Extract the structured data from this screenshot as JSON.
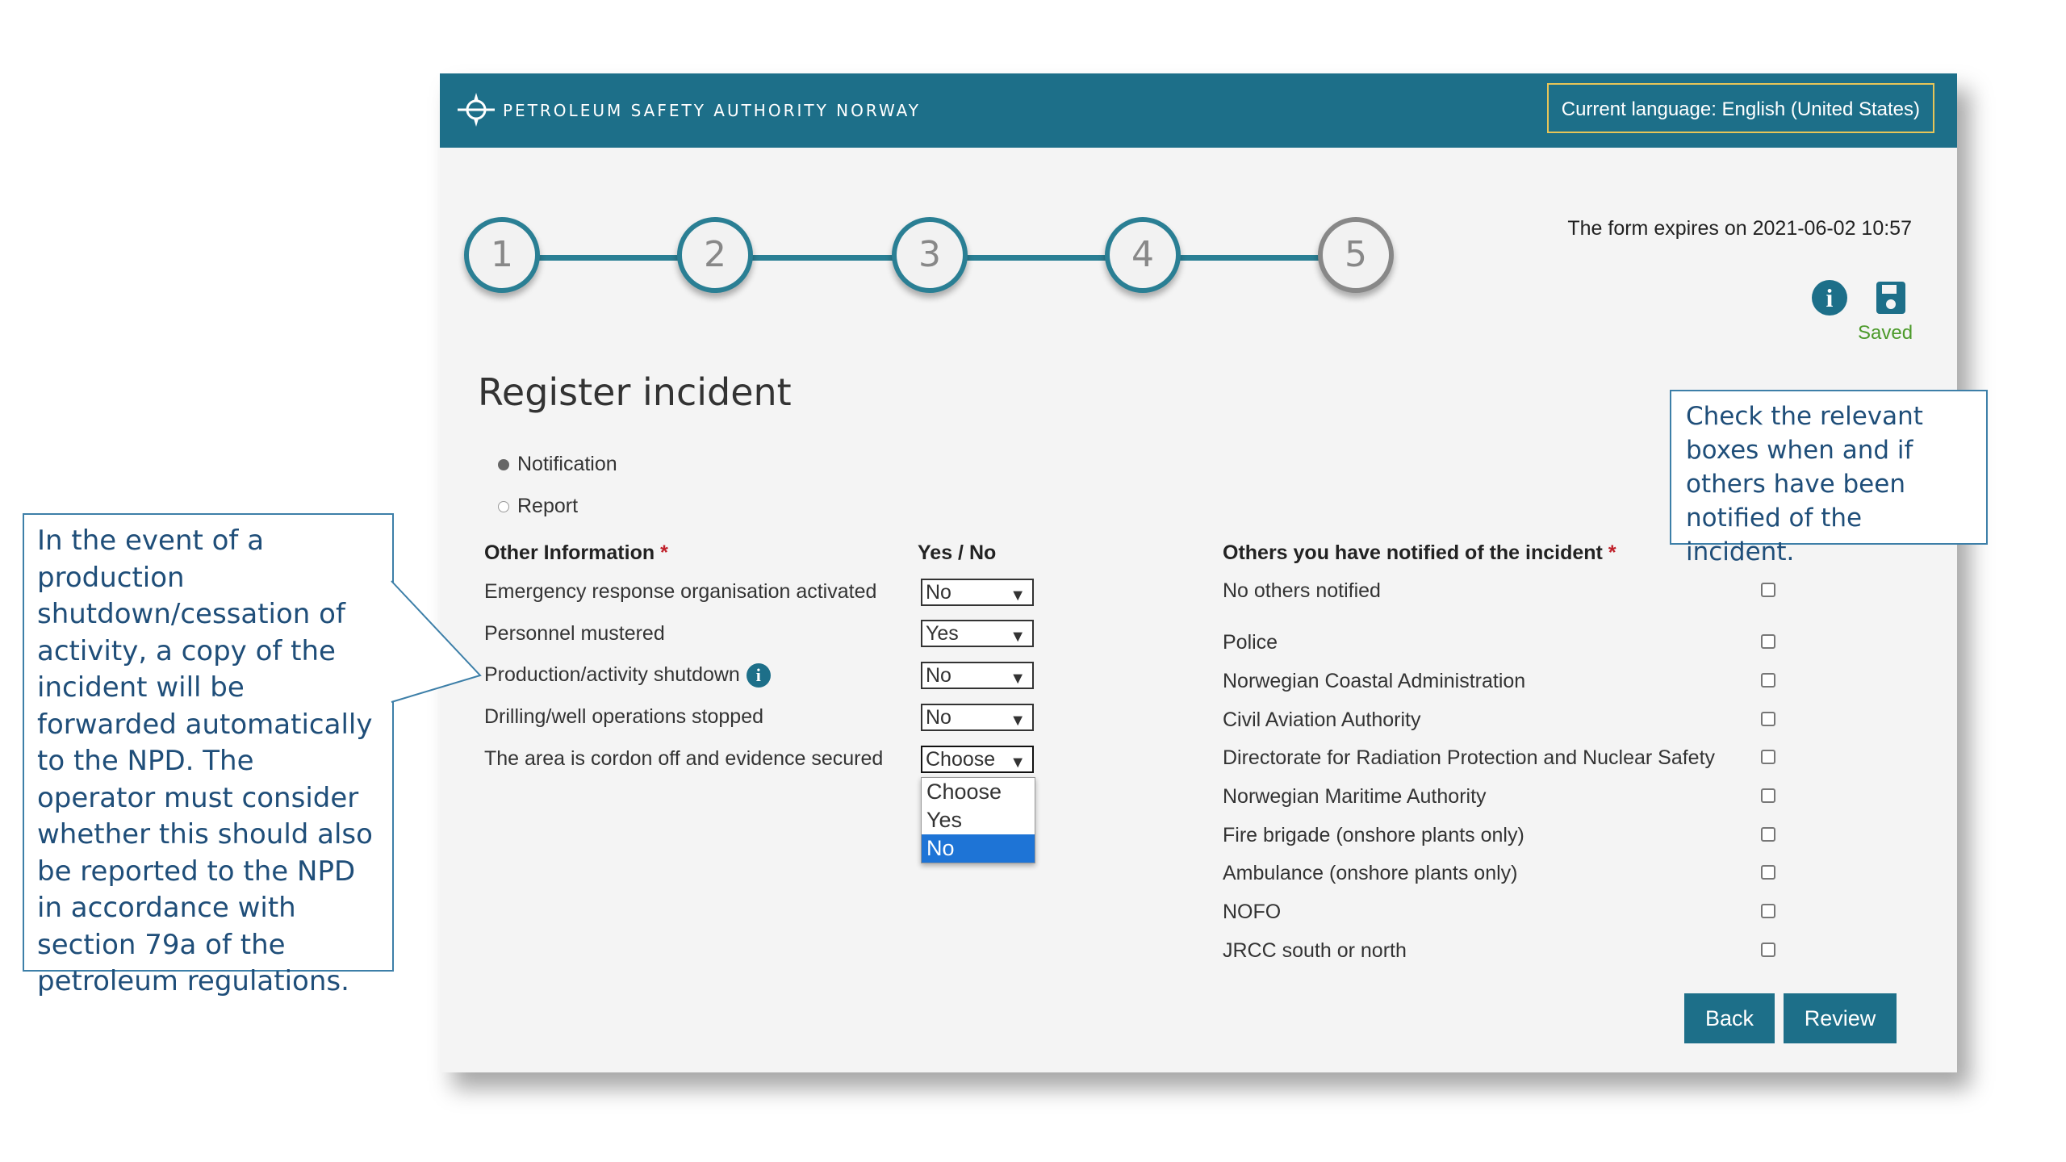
{
  "header": {
    "brand": "PETROLEUM SAFETY AUTHORITY NORWAY",
    "language_label": "Current language: English (United States)"
  },
  "stepper": {
    "steps": [
      "1",
      "2",
      "3",
      "4",
      "5"
    ]
  },
  "status": {
    "expires": "The form expires on 2021-06-02 10:57",
    "saved": "Saved"
  },
  "page_title": "Register incident",
  "notice_type": {
    "options": [
      "Notification",
      "Report"
    ],
    "selected": "Notification"
  },
  "other_info": {
    "heading": "Other Information",
    "yes_no_heading": "Yes / No",
    "questions": [
      {
        "label": "Emergency response organisation activated",
        "value": "No"
      },
      {
        "label": "Personnel mustered",
        "value": "Yes"
      },
      {
        "label": "Production/activity shutdown",
        "value": "No"
      },
      {
        "label": "Drilling/well operations stopped",
        "value": "No"
      },
      {
        "label": "The area is cordon off and evidence secured",
        "value": "Choose"
      }
    ],
    "dropdown_options": [
      "Choose",
      "Yes",
      "No"
    ],
    "dropdown_highlighted": "No"
  },
  "others_notified": {
    "heading": "Others you have notified of the incident",
    "items": [
      "No others notified",
      "Police",
      "Norwegian Coastal Administration",
      "Civil Aviation Authority",
      "Directorate for Radiation Protection and Nuclear Safety",
      "Norwegian Maritime Authority",
      "Fire brigade (onshore plants only)",
      "Ambulance (onshore plants only)",
      "NOFO",
      "JRCC south or north"
    ]
  },
  "buttons": {
    "back": "Back",
    "review": "Review"
  },
  "callouts": {
    "left": "In the event of a production shutdown/cessation of activity, a copy of the incident will be forwarded automatically to the NPD. The operator must consider whether this should also be reported to the NPD in accordance with section 79a of the petroleum regulations.",
    "right": "Check the relevant boxes when and if others have been notified of the incident."
  },
  "colors": {
    "header": "#1d6f89",
    "accent": "#1d6f89",
    "saved": "#4c9a2a",
    "required": "#c0202a",
    "callout_text": "#1f4e79"
  }
}
